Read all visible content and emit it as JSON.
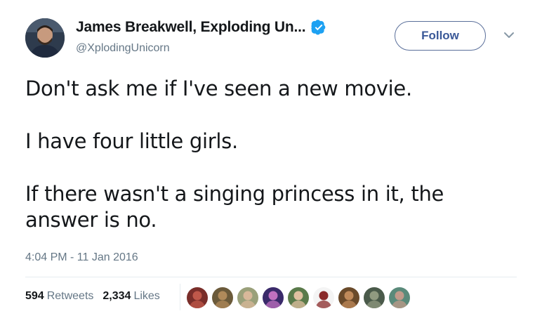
{
  "tweet": {
    "author": {
      "display_name": "James Breakwell, Exploding Un...",
      "handle": "@XplodingUnicorn",
      "verified": true
    },
    "follow_label": "Follow",
    "text_paragraphs": [
      "Don't ask me if I've seen a new movie.",
      "I have four little girls.",
      "If there wasn't a singing princess in it, the answer is no."
    ],
    "timestamp": "4:04 PM - 11 Jan 2016",
    "stats": {
      "retweets_count": "594",
      "retweets_label": "Retweets",
      "likes_count": "2,334",
      "likes_label": "Likes"
    },
    "likers": [
      {
        "name": "liker-1",
        "bg": "#7a2e2a",
        "fg": "#c0584a"
      },
      {
        "name": "liker-2",
        "bg": "#6b5a3a",
        "fg": "#b08a5a"
      },
      {
        "name": "liker-3",
        "bg": "#9aa07a",
        "fg": "#d8b89a"
      },
      {
        "name": "liker-4",
        "bg": "#3a2a6a",
        "fg": "#c070c0"
      },
      {
        "name": "liker-5",
        "bg": "#5a7a4a",
        "fg": "#e0c0a0"
      },
      {
        "name": "liker-6",
        "bg": "#f4f4f4",
        "fg": "#8a2a2a"
      },
      {
        "name": "liker-7",
        "bg": "#6a4a2a",
        "fg": "#c08a5a"
      },
      {
        "name": "liker-8",
        "bg": "#4a5a4a",
        "fg": "#909a80"
      },
      {
        "name": "liker-9",
        "bg": "#5a8a7a",
        "fg": "#c09a8a"
      }
    ],
    "colors": {
      "text": "#14171a",
      "secondary": "#657786",
      "verified_blue": "#1da1f2",
      "follow_border": "#5a6f9a",
      "divider": "#e6ecf0"
    }
  }
}
